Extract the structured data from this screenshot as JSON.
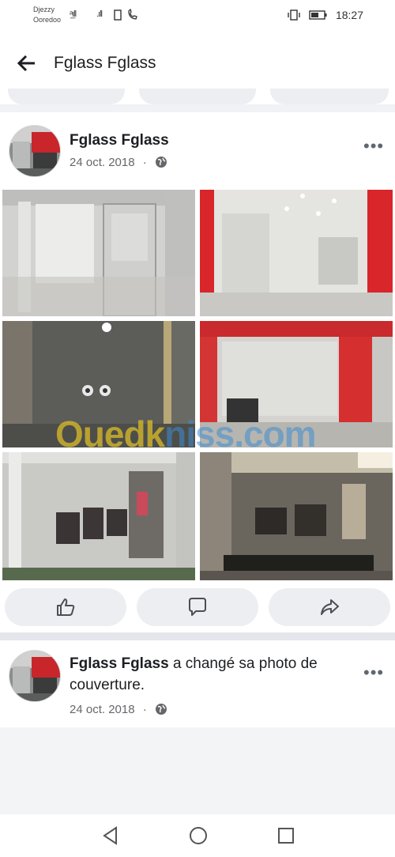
{
  "status_bar": {
    "carrier1": "Djezzy",
    "carrier2": "Ooredoo",
    "time": "18:27"
  },
  "header": {
    "title": "Fglass Fglass"
  },
  "post1": {
    "author": "Fglass Fglass",
    "date": "24 oct. 2018",
    "separator": "·",
    "more": "•••"
  },
  "post2": {
    "author": "Fglass Fglass",
    "action_text": " a changé sa photo de couverture.",
    "date": "24 oct. 2018",
    "separator": "·",
    "more": "•••"
  },
  "watermark": {
    "part1": "Ouedk",
    "part2": "niss.com"
  },
  "colors": {
    "accent_red": "#d9262c",
    "text_primary": "#1c1e21",
    "text_secondary": "#65676b",
    "button_bg": "#eceef1"
  }
}
